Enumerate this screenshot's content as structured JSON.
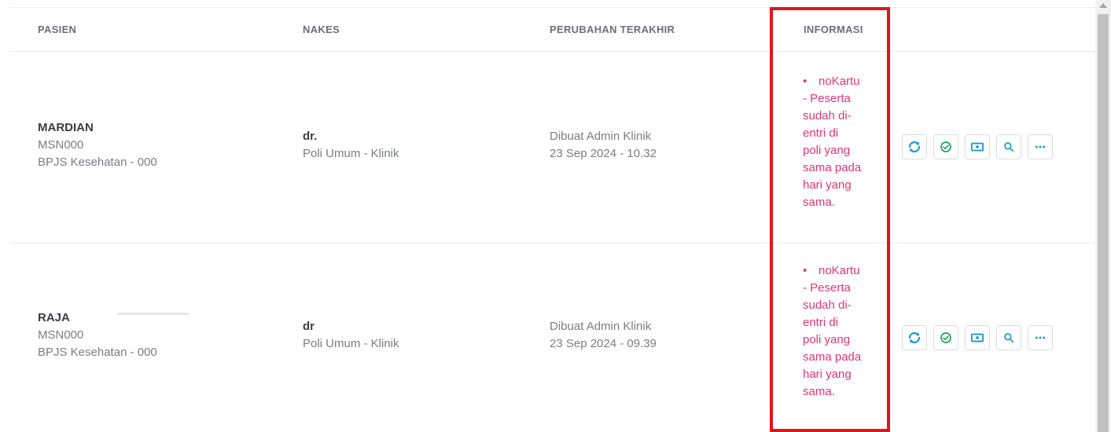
{
  "columns": {
    "pasien": "PASIEN",
    "nakes": "NAKES",
    "perubahan": "PERUBAHAN TERAKHIR",
    "informasi": "INFORMASI"
  },
  "rows": [
    {
      "patient_name": "MARDIAN",
      "patient_id": "MSN000",
      "patient_insurance": "BPJS Kesehatan - 000",
      "nakes_name": "dr.",
      "nakes_poli": "Poli Umum - Klinik",
      "changed_by": "Dibuat Admin Klinik",
      "changed_at": "23 Sep 2024 - 10.32",
      "info_bullet": "•",
      "info_lines": [
        "noKartu",
        "- Peserta",
        "sudah di-",
        "entri di",
        "poli yang",
        "sama pada",
        "hari yang",
        "sama."
      ]
    },
    {
      "patient_name": "RAJA",
      "patient_id": "MSN000",
      "patient_insurance": "BPJS Kesehatan - 000",
      "nakes_name": "dr",
      "nakes_poli": "Poli Umum - Klinik",
      "changed_by": "Dibuat Admin Klinik",
      "changed_at": "23 Sep 2024 - 09.39",
      "info_bullet": "•",
      "info_lines": [
        "noKartu",
        "- Peserta",
        "sudah di-",
        "entri di",
        "poli yang",
        "sama pada",
        "hari yang",
        "sama."
      ]
    }
  ],
  "action_icons": [
    "sync-icon",
    "check-circle-icon",
    "money-icon",
    "search-icon",
    "more-icon"
  ],
  "colors": {
    "info_text": "#e0357a",
    "highlight_border": "#e0151b",
    "icon_blue": "#1a9ad6",
    "icon_green": "#1aa65a"
  }
}
